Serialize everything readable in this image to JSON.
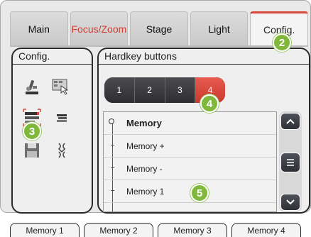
{
  "tabs": [
    {
      "label": "Main"
    },
    {
      "label": "Focus/Zoom"
    },
    {
      "label": "Stage"
    },
    {
      "label": "Light"
    },
    {
      "label": "Config."
    }
  ],
  "left_panel": {
    "title": "Config."
  },
  "right_panel": {
    "title": "Hardkey buttons"
  },
  "segments": [
    "1",
    "2",
    "3",
    "4"
  ],
  "selected_segment": "4",
  "memory_list": [
    "Memory",
    "Memory +",
    "Memory -",
    "Memory 1"
  ],
  "bottom_tabs": [
    "Memory 1",
    "Memory 2",
    "Memory 3",
    "Memory 4"
  ],
  "callouts": [
    "2",
    "3",
    "4",
    "5"
  ],
  "colors": {
    "accent_red": "#d9453a",
    "callout_green": "#7fb83b",
    "dark_button": "#3a3a3e"
  }
}
